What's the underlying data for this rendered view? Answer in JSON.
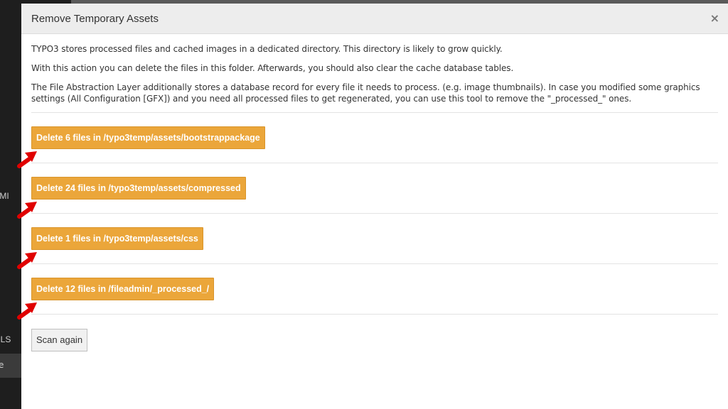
{
  "backdrop": {
    "label_1": "GEMI",
    "label_2": "DLS",
    "active_item": "e"
  },
  "modal": {
    "title": "Remove Temporary Assets",
    "close_label": "×",
    "intro": [
      "TYPO3 stores processed files and cached images in a dedicated directory. This directory is likely to grow quickly.",
      "With this action you can delete the files in this folder. Afterwards, you should also clear the cache database tables.",
      "The File Abstraction Layer additionally stores a database record for every file it needs to process. (e.g. image thumbnails). In case you modified some graphics settings (All Configuration [GFX]) and you need all processed files to get regenerated, you can use this tool to remove the \"_processed_\" ones."
    ],
    "actions": [
      {
        "label": "Delete 6 files in /typo3temp/assets/bootstrappackage"
      },
      {
        "label": "Delete 24 files in /typo3temp/assets/compressed"
      },
      {
        "label": "Delete 1 files in /typo3temp/assets/css"
      },
      {
        "label": "Delete 12 files in /fileadmin/_processed_/"
      }
    ],
    "scan_label": "Scan again"
  },
  "colors": {
    "action_button": "#eba63a",
    "annotation_arrow": "#e00000"
  },
  "icons": {
    "close": "close-icon",
    "arrow": "red-pointer-arrow-icon"
  }
}
